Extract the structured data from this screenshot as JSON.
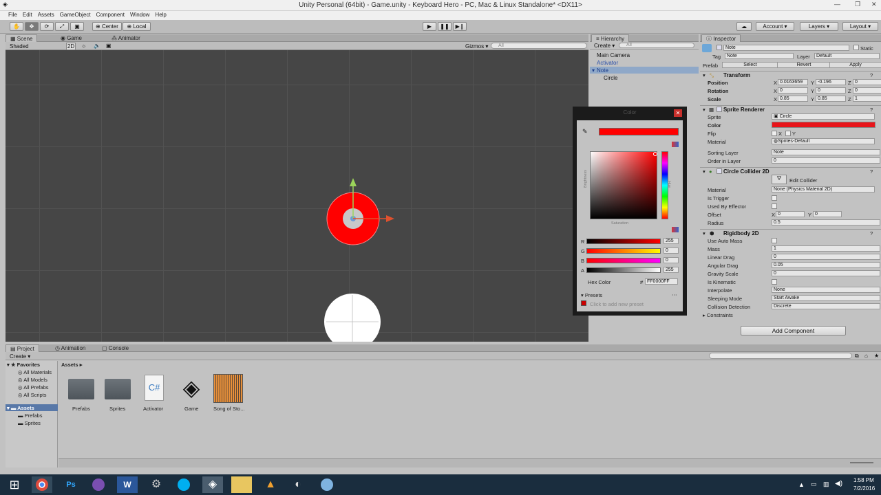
{
  "window": {
    "title": "Unity Personal (64bit) - Game.unity - Keyboard Hero - PC, Mac & Linux Standalone* <DX11>"
  },
  "menu": [
    "File",
    "Edit",
    "Assets",
    "GameObject",
    "Component",
    "Window",
    "Help"
  ],
  "toolbar": {
    "center": "Center",
    "local": "Local",
    "account": "Account",
    "layers": "Layers",
    "layout": "Layout"
  },
  "scene": {
    "tabs": [
      "Scene",
      "Game",
      "Animator"
    ],
    "shading": "Shaded",
    "mode2d": "2D",
    "gizmos": "Gizmos",
    "search_placeholder": "All"
  },
  "hierarchy": {
    "tab": "Hierarchy",
    "create": "Create",
    "search_placeholder": "All",
    "items": [
      "Main Camera",
      "Activator",
      "Note",
      "Circle"
    ]
  },
  "color_picker": {
    "title": "Color",
    "hex_label": "Hex Color",
    "hex_value": "FF0000FF",
    "r_label": "R",
    "r": "255",
    "g_label": "G",
    "g": "0",
    "b_label": "B",
    "b": "0",
    "a_label": "A",
    "a": "255",
    "brightness": "Brightness",
    "saturation": "Saturation",
    "hue": "Hue",
    "presets": "Presets",
    "add_preset": "Click to add new preset",
    "selected_color": "#ff0000"
  },
  "inspector": {
    "tab": "Inspector",
    "name": "Note",
    "static": "Static",
    "tag_label": "Tag",
    "tag": "Note",
    "layer_label": "Layer",
    "layer": "Default",
    "prefab_label": "Prefab",
    "select": "Select",
    "revert": "Revert",
    "apply": "Apply",
    "transform": {
      "title": "Transform",
      "position": "Position",
      "rotation": "Rotation",
      "scale": "Scale",
      "px": "0.0163659",
      "py": "-0.196",
      "pz": "0",
      "rx": "0",
      "ry": "0",
      "rz": "0",
      "sx": "0.85",
      "sy": "0.85",
      "sz": "1"
    },
    "sprite_renderer": {
      "title": "Sprite Renderer",
      "sprite_label": "Sprite",
      "sprite": "Circle",
      "color_label": "Color",
      "flip_label": "Flip",
      "material_label": "Material",
      "material": "Sprites-Default",
      "sorting_layer_label": "Sorting Layer",
      "sorting_layer": "Note",
      "order_label": "Order in Layer",
      "order": "0"
    },
    "circle_collider": {
      "title": "Circle Collider 2D",
      "edit": "Edit Collider",
      "material_label": "Material",
      "material": "None (Physics Material 2D)",
      "trigger": "Is Trigger",
      "effector": "Used By Effector",
      "offset": "Offset",
      "ox": "0",
      "oy": "0",
      "radius_label": "Radius",
      "radius": "0.5"
    },
    "rigidbody": {
      "title": "Rigidbody 2D",
      "auto_mass": "Use Auto Mass",
      "mass_label": "Mass",
      "mass": "1",
      "linear_label": "Linear Drag",
      "linear": "0",
      "angular_label": "Angular Drag",
      "angular": "0.05",
      "gravity_label": "Gravity Scale",
      "gravity": "0",
      "kinematic": "Is Kinematic",
      "interpolate_label": "Interpolate",
      "interpolate": "None",
      "sleeping_label": "Sleeping Mode",
      "sleeping": "Start Awake",
      "collision_label": "Collision Detection",
      "collision": "Discrete",
      "constraints": "Constraints"
    },
    "add_component": "Add Component"
  },
  "project": {
    "tabs": [
      "Project",
      "Animation",
      "Console"
    ],
    "create": "Create",
    "favorites": "Favorites",
    "fav_items": [
      "All Materials",
      "All Models",
      "All Prefabs",
      "All Scripts"
    ],
    "assets": "Assets",
    "asset_folders": [
      "Prefabs",
      "Sprites"
    ],
    "breadcrumb": "Assets",
    "items": [
      "Prefabs",
      "Sprites",
      "Activator",
      "Game",
      "Song of Sto..."
    ]
  },
  "taskbar": {
    "time": "1:58 PM",
    "date": "7/2/2016"
  }
}
